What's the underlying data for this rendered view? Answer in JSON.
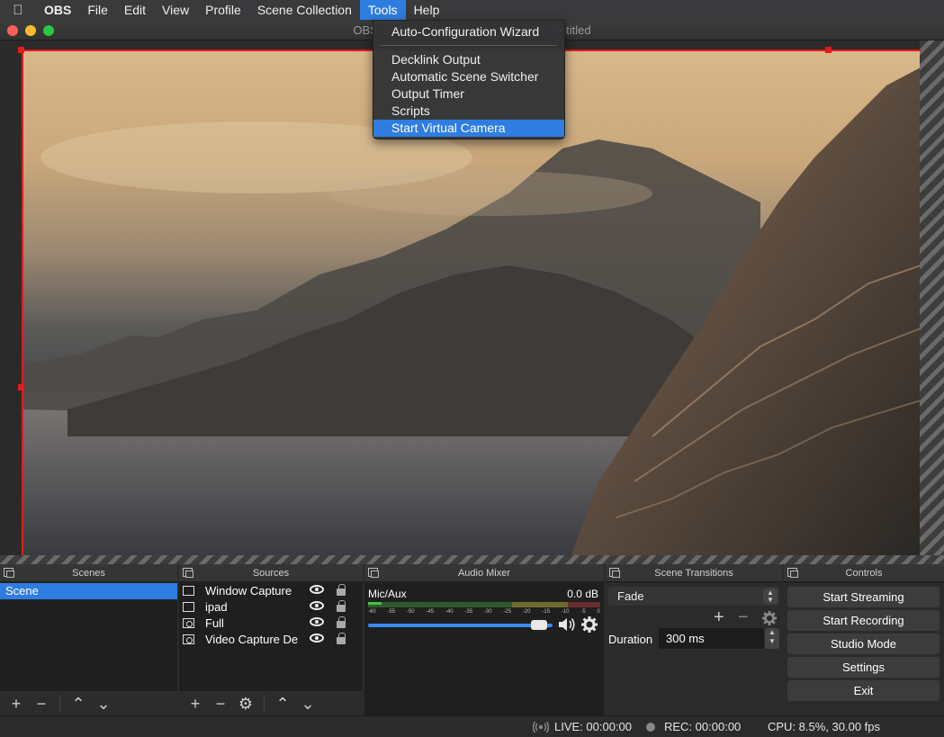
{
  "menubar": {
    "items": [
      "OBS",
      "File",
      "Edit",
      "View",
      "Profile",
      "Scene Collection",
      "Tools",
      "Help"
    ],
    "active_item": "Tools"
  },
  "window": {
    "title": "OBS 25.0 ... s: Untitled",
    "title_left": "OBS 25.0",
    "title_right": "s: Untitled"
  },
  "tools_menu": {
    "items": [
      {
        "label": "Auto-Configuration Wizard"
      },
      {
        "label": "Decklink Output"
      },
      {
        "label": "Automatic Scene Switcher"
      },
      {
        "label": "Output Timer"
      },
      {
        "label": "Scripts"
      },
      {
        "label": "Start Virtual Camera",
        "highlighted": true
      }
    ]
  },
  "docks": {
    "scenes": {
      "title": "Scenes",
      "items": [
        "Scene"
      ]
    },
    "sources": {
      "title": "Sources",
      "items": [
        {
          "name": "Window Capture",
          "icon": "window-icon"
        },
        {
          "name": "ipad",
          "icon": "window-icon"
        },
        {
          "name": "Full",
          "icon": "camera-icon"
        },
        {
          "name": "Video Capture De",
          "icon": "camera-icon"
        }
      ]
    },
    "audio_mixer": {
      "title": "Audio Mixer",
      "channel": "Mic/Aux",
      "level": "0.0 dB",
      "ticks": [
        "-60",
        "-55",
        "-50",
        "-45",
        "-40",
        "-35",
        "-30",
        "-25",
        "-20",
        "-15",
        "-10",
        "-5",
        "0"
      ],
      "volume_fraction": 0.97,
      "meter_fraction": 0.06
    },
    "transitions": {
      "title": "Scene Transitions",
      "selected": "Fade",
      "duration_label": "Duration",
      "duration_value": "300 ms"
    },
    "controls": {
      "title": "Controls",
      "buttons": [
        "Start Streaming",
        "Start Recording",
        "Studio Mode",
        "Settings",
        "Exit"
      ]
    }
  },
  "status": {
    "live": "LIVE: 00:00:00",
    "rec": "REC: 00:00:00",
    "cpu": "CPU: 8.5%, 30.00 fps"
  },
  "colors": {
    "accent": "#2f7de1",
    "selection": "#e21c1c",
    "background": "#2a2a2a"
  }
}
